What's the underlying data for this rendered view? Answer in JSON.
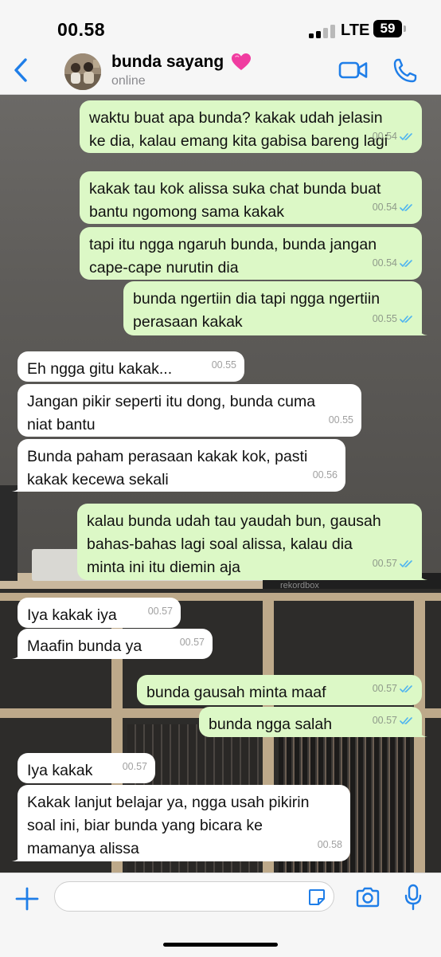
{
  "status_bar": {
    "time": "00.58",
    "network": "LTE",
    "battery": "59"
  },
  "header": {
    "contact_name": "bunda sayang",
    "contact_status": "online",
    "back_icon": "chevron-left-icon",
    "video_icon": "video-camera-icon",
    "call_icon": "phone-icon",
    "heart_icon": "pink-heart-icon"
  },
  "messages": [
    {
      "dir": "out",
      "lines": [
        "waktu buat apa bunda? kakak udah jelasin",
        "ke dia, kalau emang kita gabisa bareng lagi"
      ],
      "time": "00.54",
      "read": true
    },
    {
      "dir": "out",
      "lines": [
        "kakak tau kok alissa suka chat bunda buat",
        "bantu ngomong sama kakak"
      ],
      "time": "00.54",
      "read": true
    },
    {
      "dir": "out",
      "lines": [
        "tapi itu ngga ngaruh bunda, bunda jangan",
        "cape-cape nurutin dia"
      ],
      "time": "00.54",
      "read": true
    },
    {
      "dir": "out",
      "lines": [
        "bunda ngertiin dia tapi ngga ngertiin",
        "perasaan kakak"
      ],
      "time": "00.55",
      "read": true
    },
    {
      "dir": "in",
      "lines": [
        "Eh ngga gitu kakak..."
      ],
      "time": "00.55"
    },
    {
      "dir": "in",
      "lines": [
        "Jangan pikir seperti itu dong, bunda cuma",
        "niat bantu"
      ],
      "time": "00.55"
    },
    {
      "dir": "in",
      "lines": [
        "Bunda paham perasaan kakak kok, pasti",
        "kakak kecewa sekali"
      ],
      "time": "00.56"
    },
    {
      "dir": "out",
      "lines": [
        "kalau bunda udah tau yaudah bun, gausah",
        "bahas-bahas lagi soal alissa, kalau dia",
        "minta ini itu diemin aja"
      ],
      "time": "00.57",
      "read": true
    },
    {
      "dir": "in",
      "lines": [
        "Iya kakak iya"
      ],
      "time": "00.57"
    },
    {
      "dir": "in",
      "lines": [
        "Maafin bunda ya"
      ],
      "time": "00.57"
    },
    {
      "dir": "out",
      "lines": [
        "bunda gausah minta maaf"
      ],
      "time": "00.57",
      "read": true
    },
    {
      "dir": "out",
      "lines": [
        "bunda ngga salah"
      ],
      "time": "00.57",
      "read": true
    },
    {
      "dir": "in",
      "lines": [
        "Iya kakak"
      ],
      "time": "00.57"
    },
    {
      "dir": "in",
      "lines": [
        "Kakak lanjut belajar ya, ngga usah pikirin",
        "soal ini, biar bunda yang bicara ke",
        "mamanya alissa"
      ],
      "time": "00.58"
    }
  ],
  "background_text": "rekordbox",
  "composer": {
    "placeholder": "",
    "plus_icon": "plus-icon",
    "sticker_icon": "sticker-icon",
    "camera_icon": "camera-icon",
    "mic_icon": "microphone-icon"
  },
  "colors": {
    "accent": "#1f7ee8",
    "outgoing_bubble": "#dcf8c6",
    "incoming_bubble": "#ffffff",
    "read_ticks": "#4fb4f0"
  }
}
